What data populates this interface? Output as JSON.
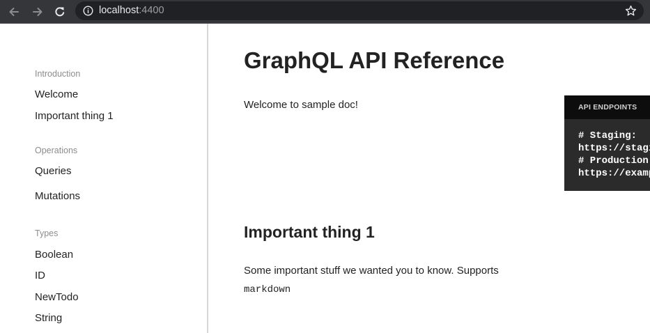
{
  "browser": {
    "url_host": "localhost",
    "url_port": ":4400"
  },
  "sidebar": {
    "sections": [
      {
        "heading": "Introduction",
        "items": [
          "Welcome",
          "Important thing 1"
        ]
      },
      {
        "heading": "Operations",
        "items": [
          "Queries",
          "Mutations"
        ]
      },
      {
        "heading": "Types",
        "items": [
          "Boolean",
          "ID",
          "NewTodo",
          "String"
        ]
      }
    ]
  },
  "main": {
    "title": "GraphQL API Reference",
    "intro": "Welcome to sample doc!",
    "section_title": "Important thing 1",
    "section_text": "Some important stuff we wanted you to know. Supports",
    "section_code": "markdown"
  },
  "endpoints": {
    "title": "API ENDPOINTS",
    "lines": [
      "# Staging:",
      "https://staging.example.com/graphql",
      "# Production:",
      "https://example.com/graphql"
    ]
  }
}
